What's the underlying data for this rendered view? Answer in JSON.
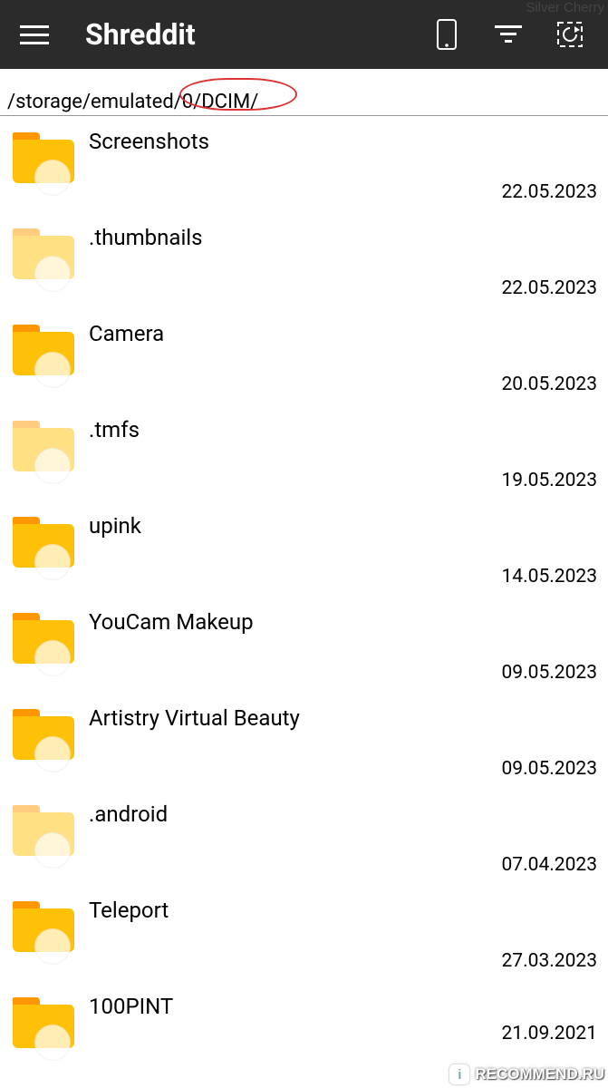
{
  "watermarks": {
    "top": "Silver Cherry",
    "bottom_badge": "i",
    "bottom_text": "RECOMMEND.RU"
  },
  "header": {
    "title": "Shreddit"
  },
  "path": "/storage/emulated/0/DCIM/",
  "folders": [
    {
      "name": "Screenshots",
      "date": "22.05.2023",
      "faded": false
    },
    {
      "name": ".thumbnails",
      "date": "22.05.2023",
      "faded": true
    },
    {
      "name": "Camera",
      "date": "20.05.2023",
      "faded": false
    },
    {
      "name": ".tmfs",
      "date": "19.05.2023",
      "faded": true
    },
    {
      "name": "upink",
      "date": "14.05.2023",
      "faded": false
    },
    {
      "name": "YouCam Makeup",
      "date": "09.05.2023",
      "faded": false
    },
    {
      "name": "Artistry Virtual Beauty",
      "date": "09.05.2023",
      "faded": false
    },
    {
      "name": ".android",
      "date": "07.04.2023",
      "faded": true
    },
    {
      "name": "Teleport",
      "date": "27.03.2023",
      "faded": false
    },
    {
      "name": "100PINT",
      "date": "21.09.2021",
      "faded": false
    }
  ]
}
